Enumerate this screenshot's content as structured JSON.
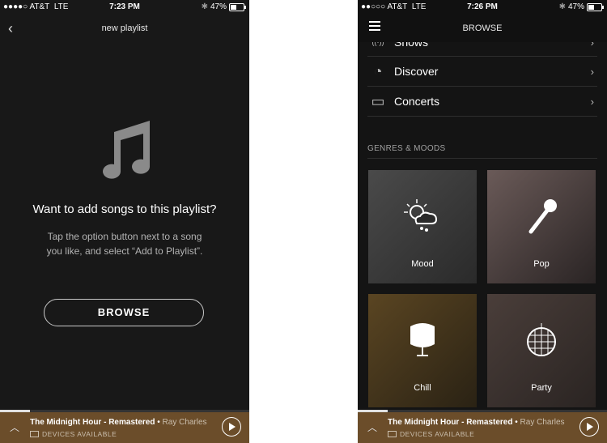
{
  "screen1": {
    "status": {
      "signal": "●●●●○",
      "carrier": "AT&T",
      "network": "LTE",
      "time": "7:23 PM",
      "bluetooth": "✱",
      "battery": "47%",
      "battery_level": 0.47
    },
    "nav": {
      "title": "new playlist",
      "back_icon": "‹"
    },
    "empty": {
      "title": "Want to add songs to this playlist?",
      "description": "Tap the option button next to a song you like, and select “Add to Playlist”."
    },
    "browse_button": "BROWSE"
  },
  "screen2": {
    "status": {
      "signal": "●●○○○",
      "carrier": "AT&T",
      "network": "LTE",
      "time": "7:26 PM",
      "bluetooth": "✱",
      "battery": "47%",
      "battery_level": 0.47
    },
    "nav": {
      "title": "BROWSE"
    },
    "list": [
      {
        "label": "Shows",
        "icon": "podcast-icon",
        "glyph": "((·))"
      },
      {
        "label": "Discover",
        "icon": "discover-icon",
        "glyph": "◔"
      },
      {
        "label": "Concerts",
        "icon": "ticket-icon",
        "glyph": "▭"
      }
    ],
    "section_title": "GENRES & MOODS",
    "genres": [
      {
        "label": "Mood",
        "icon": "weather-icon",
        "bg": "#3a3a3a"
      },
      {
        "label": "Pop",
        "icon": "microphone-icon",
        "bg": "#4a4040"
      },
      {
        "label": "Chill",
        "icon": "chair-icon",
        "bg": "#4a3b1e"
      },
      {
        "label": "Party",
        "icon": "disco-ball-icon",
        "bg": "#3e3532"
      }
    ]
  },
  "player": {
    "track": "The Midnight Hour - Remastered",
    "separator": "•",
    "artist": "Ray Charles",
    "devices": "DEVICES AVAILABLE",
    "progress": 0.12,
    "color": "#6b4d2a"
  }
}
